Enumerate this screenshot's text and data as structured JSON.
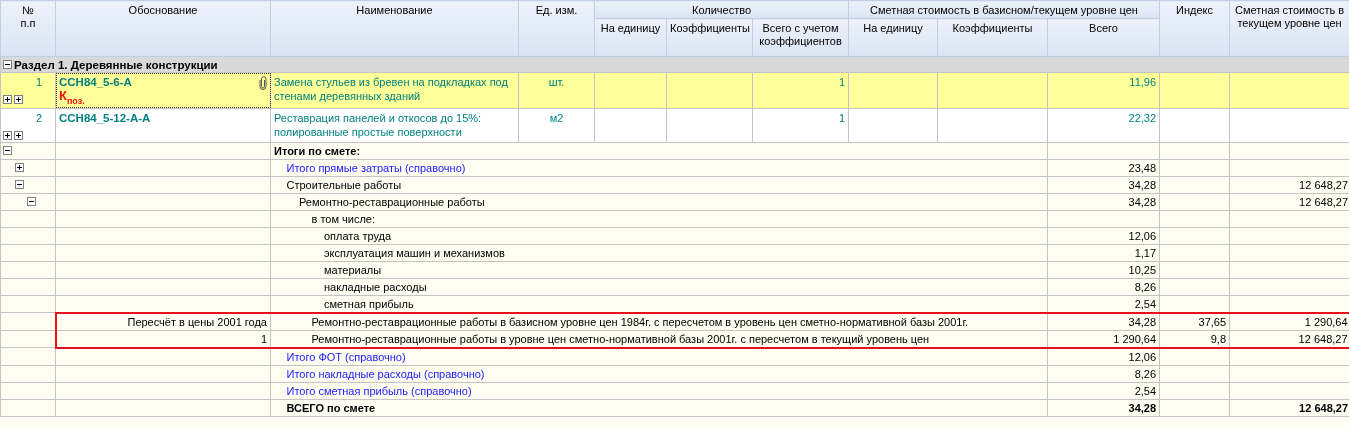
{
  "columns": [
    {
      "label": "№ п.п"
    },
    {
      "label": "Обоснование"
    },
    {
      "label": "Наименование"
    },
    {
      "label": "Ед. изм."
    },
    {
      "label": "Количество",
      "subcolumns": [
        "На единицу",
        "Коэффициенты",
        "Всего с учетом коэффициентов"
      ]
    },
    {
      "label": "Сметная стоимость в базисном/текущем уровне цен",
      "subcolumns": [
        "На единицу",
        "Коэффициенты",
        "Всего"
      ]
    },
    {
      "label": "Индекс"
    },
    {
      "label": "Сметная стоимость в текущем уровне цен"
    }
  ],
  "section": {
    "title": "Раздел 1. Деревянные конструкции",
    "expanded": true
  },
  "items": [
    {
      "number": "1",
      "code": "ССН84_5-6-А",
      "mark": "К$_{поз.}$",
      "attachment": true,
      "selected": true,
      "name": "Замена стульев из бревен на подкладках под стенами деревянных зданий",
      "unit": "шт.",
      "quantity": "1",
      "total": "11,96",
      "toggles": [
        {
          "expanded": false
        },
        {
          "expanded": false
        }
      ]
    },
    {
      "number": "2",
      "code": "ССН84_5-12-А-А",
      "attachment": false,
      "selected": false,
      "name": "Реставрация панелей и откосов до 15%: полированные простые поверхности",
      "unit": "м2",
      "quantity": "1",
      "total": "22,32",
      "toggles": [
        {
          "expanded": false
        },
        {
          "expanded": false
        }
      ]
    }
  ],
  "totals": {
    "name": "Итоги по смете:",
    "kind": "bold",
    "expanded": true,
    "children": [
      {
        "name": "Итого прямые затраты (справочно)",
        "kind": "link",
        "expanded": false,
        "total": "23,48"
      },
      {
        "name": "Строительные работы",
        "expanded": true,
        "total": "34,28",
        "current": "12 648,27",
        "children": [
          {
            "name": "Ремонтно-реставрационные работы",
            "expanded": true,
            "total": "34,28",
            "current": "12 648,27",
            "children": [
              {
                "name": "в том числе:",
                "children": [
                  {
                    "name": "оплата труда",
                    "total": "12,06"
                  },
                  {
                    "name": "эксплуатация машин и механизмов",
                    "total": "1,17"
                  },
                  {
                    "name": "материалы",
                    "total": "10,25"
                  },
                  {
                    "name": "накладные расходы",
                    "total": "8,26"
                  },
                  {
                    "name": "сметная прибыль",
                    "total": "2,54"
                  }
                ]
              },
              {
                "basis": "Пересчёт в цены 2001 года",
                "name": "Ремонтно-реставрационные работы в базисном уровне цен 1984г. с пересчетом в уровень цен сметно-нормативной базы 2001г.",
                "highlighted": true,
                "total": "34,28",
                "index": "37,65",
                "current": "1 290,64"
              },
              {
                "basis": "1",
                "name": "Ремонтно-реставрационные работы в уровне цен сметно-нормативной базы 2001г. с пересчетом в текущий уровень цен",
                "highlighted": true,
                "total": "1 290,64",
                "index": "9,8",
                "current": "12 648,27"
              }
            ]
          }
        ]
      },
      {
        "name": "Итого ФОТ (справочно)",
        "kind": "link",
        "total": "12,06"
      },
      {
        "name": "Итого накладные расходы (справочно)",
        "kind": "link",
        "total": "8,26"
      },
      {
        "name": "Итого сметная прибыль (справочно)",
        "kind": "link",
        "total": "2,54"
      },
      {
        "name": "ВСЕГО по смете",
        "kind": "bold",
        "total": "34,28",
        "current": "12 648,27"
      }
    ]
  }
}
